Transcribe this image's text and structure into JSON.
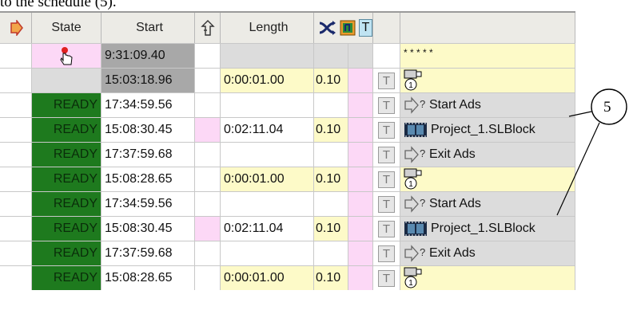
{
  "caption": "to the schedule (5).",
  "columns": {
    "state": "State",
    "start": "Start",
    "length": "Length"
  },
  "header_icons": [
    "play-arrow-icon",
    "jump-up-icon",
    "shuffle-icon",
    "overlay-icon",
    "text-toggle-icon"
  ],
  "header_t_label": "T",
  "row0": {
    "start": "9:31:09.40",
    "name": "* * * * *"
  },
  "row1": {
    "start": "15:03:18.96",
    "length": "0:00:01.00",
    "speed": "0.10",
    "t": "T"
  },
  "row2": {
    "state": "READY",
    "start": "17:34:59.56",
    "t": "T",
    "name": "Start Ads"
  },
  "row3": {
    "state": "READY",
    "start": "15:08:30.45",
    "length": "0:02:11.04",
    "speed": "0.10",
    "t": "T",
    "name": "Project_1.SLBlock"
  },
  "row4": {
    "state": "READY",
    "start": "17:37:59.68",
    "t": "T",
    "name": "Exit Ads"
  },
  "row5": {
    "state": "READY",
    "start": "15:08:28.65",
    "length": "0:00:01.00",
    "speed": "0.10",
    "t": "T"
  },
  "row6": {
    "state": "READY",
    "start": "17:34:59.56",
    "t": "T",
    "name": "Start Ads"
  },
  "row7": {
    "state": "READY",
    "start": "15:08:30.45",
    "length": "0:02:11.04",
    "speed": "0.10",
    "t": "T",
    "name": "Project_1.SLBlock"
  },
  "row8": {
    "state": "READY",
    "start": "17:37:59.68",
    "t": "T",
    "name": "Exit Ads"
  },
  "row9": {
    "state": "READY",
    "start": "15:08:28.65",
    "length": "0:00:01.00",
    "speed": "0.10",
    "t": "T"
  },
  "callout": "5",
  "colors": {
    "ready": "#1e7a1e",
    "pink": "#fcd8f6",
    "yellow": "#fdfac8",
    "header": "#ecebe6"
  }
}
